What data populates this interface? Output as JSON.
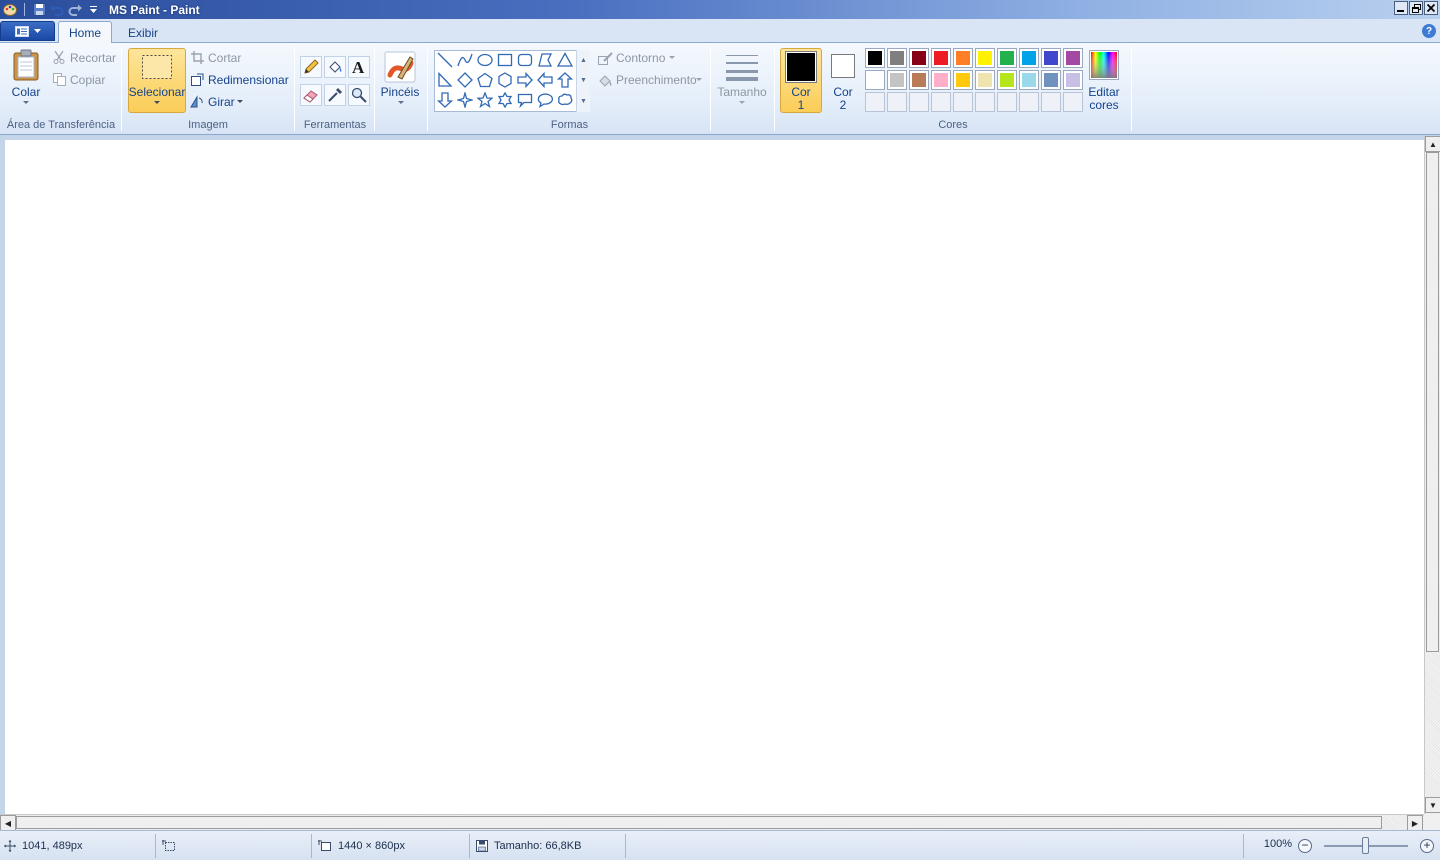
{
  "window": {
    "title": "MS Paint - Paint"
  },
  "tabs": [
    {
      "label": "Home",
      "active": true
    },
    {
      "label": "Exibir",
      "active": false
    }
  ],
  "clipboard": {
    "paste_label": "Colar",
    "cut_label": "Recortar",
    "copy_label": "Copiar",
    "group_label": "Área de Transferência"
  },
  "image": {
    "select_label": "Selecionar",
    "crop_label": "Cortar",
    "resize_label": "Redimensionar",
    "rotate_label": "Girar",
    "group_label": "Imagem"
  },
  "tools": {
    "group_label": "Ferramentas",
    "items": [
      "pencil-icon",
      "fill-bucket-icon",
      "text-icon",
      "eraser-icon",
      "color-picker-icon",
      "magnifier-icon"
    ]
  },
  "brushes": {
    "label": "Pincéis"
  },
  "shapes": {
    "outline_label": "Contorno",
    "fill_label": "Preenchimento",
    "group_label": "Formas"
  },
  "size": {
    "label": "Tamanho"
  },
  "colors": {
    "color1_label": [
      "Cor",
      "1"
    ],
    "color2_label": [
      "Cor",
      "2"
    ],
    "color1": "#000000",
    "color2": "#ffffff",
    "edit_label": [
      "Editar",
      "cores"
    ],
    "group_label": "Cores",
    "palette_row1": [
      "#000000",
      "#7f7f7f",
      "#880015",
      "#ed1c24",
      "#ff7f27",
      "#fff200",
      "#22b14c",
      "#00a2e8",
      "#3f48cc",
      "#a349a4"
    ],
    "palette_row2": [
      "#ffffff",
      "#c3c3c3",
      "#b97a57",
      "#ffaec9",
      "#ffc90e",
      "#efe4b0",
      "#b5e61d",
      "#99d9ea",
      "#7092be",
      "#c8bfe7"
    ]
  },
  "status": {
    "cursor_pos": "1041, 489px",
    "selection_size": "",
    "canvas_size": "1440 × 860px",
    "file_size": "Tamanho: 66,8KB",
    "zoom": "100%"
  }
}
